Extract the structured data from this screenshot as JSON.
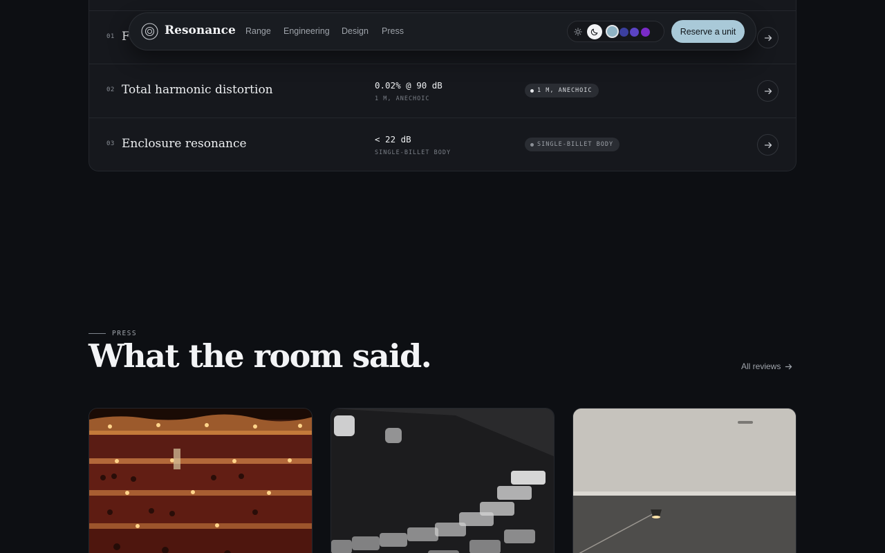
{
  "nav": {
    "brand": "Resonance",
    "links": [
      "Range",
      "Engineering",
      "Design",
      "Press"
    ],
    "cta": "Reserve a unit",
    "swatch_colors": [
      "#8fb3c4",
      "#3b3f9e",
      "#5b44c4",
      "#7a2bc8"
    ]
  },
  "specs": {
    "rows": [
      {
        "index": "01",
        "name": "F",
        "value": "",
        "sub": "",
        "tag": ""
      },
      {
        "index": "02",
        "name": "Total harmonic distortion",
        "value": "0.02% @ 90 dB",
        "sub": "1 M, ANECHOIC",
        "tag": "1 M, ANECHOIC"
      },
      {
        "index": "03",
        "name": "Enclosure resonance",
        "value": "< 22 dB",
        "sub": "SINGLE-BILLET BODY",
        "tag": "SINGLE-BILLET BODY"
      }
    ]
  },
  "press": {
    "eyebrow": "PRESS",
    "title": "What the room said.",
    "all_reviews": "All reviews",
    "cards": [
      {
        "image": "concert-hall-photo"
      },
      {
        "image": "mixing-console-photo"
      },
      {
        "image": "room-with-lamp-photo"
      }
    ]
  }
}
